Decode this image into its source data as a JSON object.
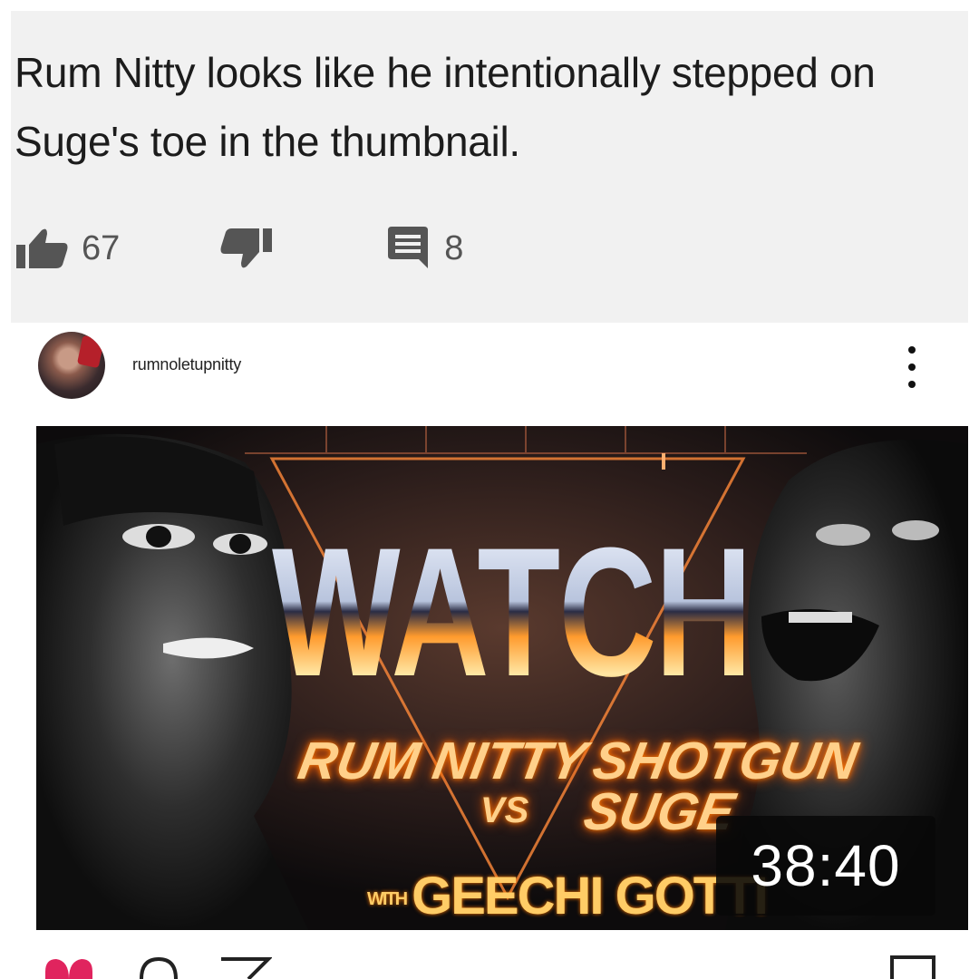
{
  "comment": {
    "text": "Rum Nitty looks like he intentionally stepped on Suge's toe in the thumbnail.",
    "likes": "67",
    "replies": "8"
  },
  "post": {
    "username": "rumnoletupnitty"
  },
  "thumbnail": {
    "headline": "WATCH",
    "left_name": "RUM NITTY",
    "versus": "VS",
    "right_name": "SHOTGUN SUGE",
    "with_label": "WITH",
    "host": "GEECHI GOTTI",
    "duration": "38:40"
  },
  "icons": [
    "thumbs-up-icon",
    "thumbs-down-icon",
    "comment-icon",
    "more-vert-icon",
    "heart-icon",
    "comment-bubble-icon",
    "send-icon",
    "bookmark-icon"
  ]
}
